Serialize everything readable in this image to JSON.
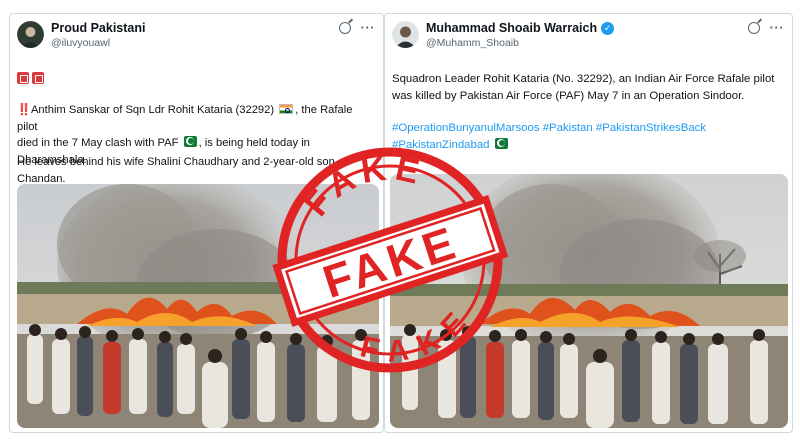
{
  "left_post": {
    "author_name": "Proud Pakistani",
    "handle": "@iluvyouawl",
    "icons": [
      "grok-icon",
      "more-icon"
    ],
    "emoji_row": [
      "red-square-emoji",
      "red-square-emoji"
    ],
    "line1_bang": "‼️",
    "line1_a": "Anthim Sanskar of Sqn Ldr Rohit Kataria (32292)",
    "line1_b": ", the Rafale pilot",
    "line2_a": "died in the 7 May clash with PAF",
    "line2_b": ", is being held today in Dharamshala.",
    "paragraph2": "He leaves behind his wife Shalini Chaudhary and 2-year-old son Chandan.",
    "image": "funeral-pyre-crowd-photo"
  },
  "right_post": {
    "author_name": "Muhammad Shoaib Warraich",
    "verified": true,
    "handle": "@Muhamm_Shoaib",
    "icons": [
      "grok-icon",
      "more-icon"
    ],
    "text": "Squadron Leader Rohit Kataria (No. 32292), an Indian Air Force Rafale pilot was killed by Pakistan Air Force (PAF) May 7 in an Operation Sindoor.",
    "hashtags_line1": "#OperationBunyanulMarsoos #Pakistan #PakistanStrikesBack",
    "hashtags_line2": "#PakistanZindabad",
    "image": "funeral-pyre-crowd-photo"
  },
  "stamp": {
    "top_word": "FAKE",
    "center_word": "FAKE",
    "bottom_word": "FAKE",
    "color": "#e02424"
  },
  "colors": {
    "link": "#1d9bf0",
    "text": "#0f1419",
    "muted": "#536471",
    "border": "#cfd9de"
  }
}
